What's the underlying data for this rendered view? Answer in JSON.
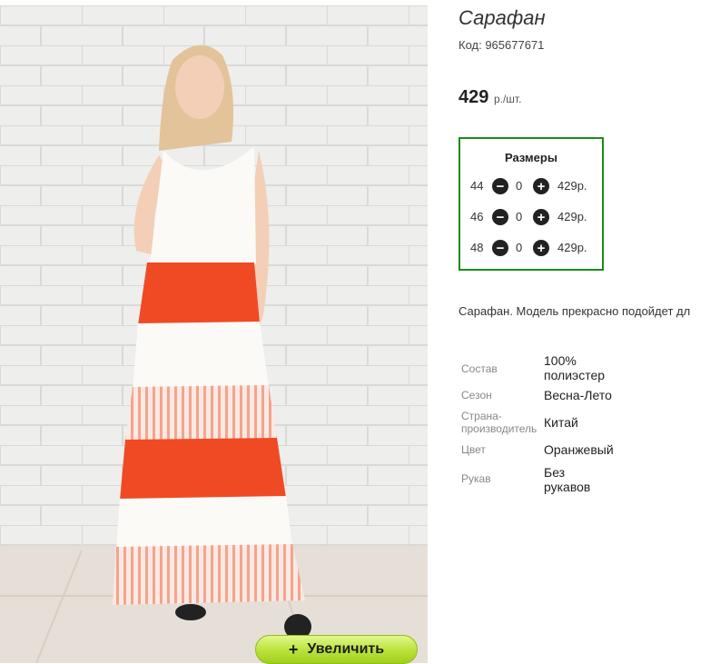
{
  "product": {
    "title": "Сарафан",
    "code": "Код: 965677671",
    "price": "429",
    "price_unit": "р./шт.",
    "zoom_label": "Увеличить",
    "zoom_icon": "plus-icon",
    "description": "Сарафан. Модель прекрасно подойдет дл"
  },
  "sizes": {
    "title": "Размеры",
    "rows": [
      {
        "size": "44",
        "qty": "0",
        "price": "429р."
      },
      {
        "size": "46",
        "qty": "0",
        "price": "429р."
      },
      {
        "size": "48",
        "qty": "0",
        "price": "429р."
      }
    ],
    "minus_glyph": "−",
    "plus_glyph": "+"
  },
  "properties": [
    {
      "label": "Состав",
      "value": "100% полиэстер"
    },
    {
      "label": "Сезон",
      "value": "Весна-Лето"
    },
    {
      "label": "Страна-производитель",
      "value": "Китай"
    },
    {
      "label": "Цвет",
      "value": "Оранжевый"
    },
    {
      "label": "Рукав",
      "value": "Без рукавов"
    }
  ],
  "colors": {
    "border_green": "#1b8a1b",
    "zoom_button": "#b9e23a",
    "dress_orange": "#f04a24"
  }
}
